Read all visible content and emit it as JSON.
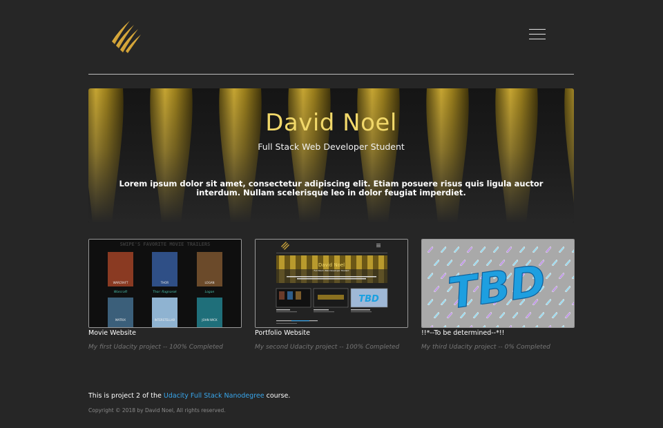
{
  "header": {
    "logo_icon": "claw-marks-logo-icon",
    "menu_icon": "hamburger-menu-icon"
  },
  "hero": {
    "title": "David Noel",
    "subtitle": "Full Stack Web Developer Student",
    "blurb": "Lorem ipsum dolor sit amet, consectetur adipiscing elit. Etiam posuere risus quis ligula auctor interdum. Nullam scelerisque leo in dolor feugiat imperdiet."
  },
  "projects": [
    {
      "title": "Movie Website",
      "description": "My first Udacity project -- 100% Completed",
      "thumb_heading": "SWIPE'S FAVORITE MOVIE TRAILERS",
      "posters": [
        "WARCRAFT",
        "THOR",
        "LOGAN",
        "Warcraft",
        "Thor: Ragnarok",
        "Logan",
        "MATRIX",
        "INTERSTELLAR",
        "JOHN WICK"
      ]
    },
    {
      "title": "Portfolio Website",
      "description": "My second Udacity project -- 100% Completed",
      "thumb_heading": "David Noel",
      "thumb_subtitle": "Full Stack Web Developer Student",
      "thumb_badge": "TBD"
    },
    {
      "title": "!!*--To be determined--*!!",
      "description": "My third Udacity project -- 0% Completed",
      "thumb_text": "TBD"
    }
  ],
  "footer": {
    "note_prefix": "This is project 2 of the ",
    "note_link": "Udacity Full Stack Nanodegree",
    "note_suffix": " course.",
    "copyright": "Copyright © 2018 by David Noel, All rights reserved."
  },
  "colors": {
    "background": "#262626",
    "accent_gold": "#f1d86a",
    "link_blue": "#38a6ec"
  }
}
